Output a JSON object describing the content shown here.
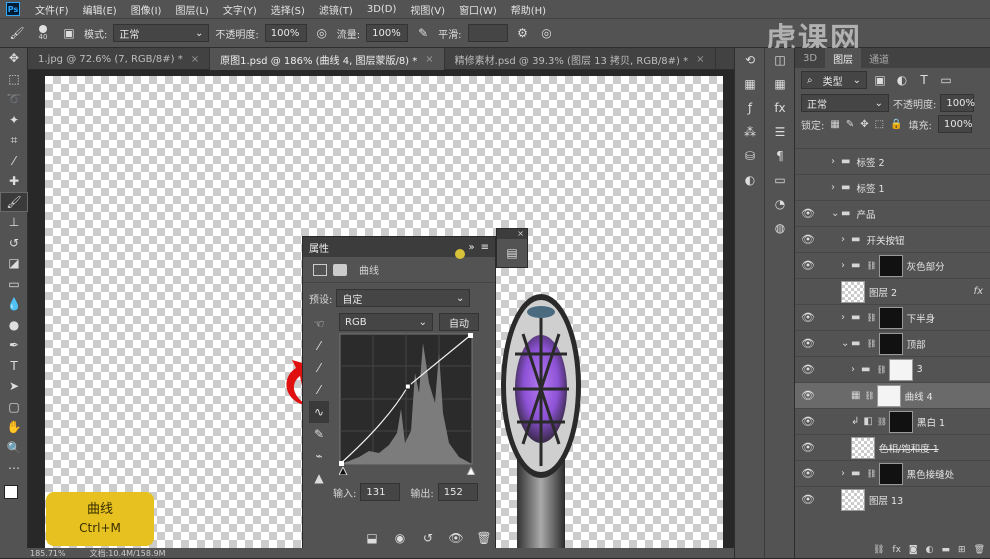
{
  "menubar": {
    "logo": "Ps",
    "items": [
      "文件(F)",
      "编辑(E)",
      "图像(I)",
      "图层(L)",
      "文字(Y)",
      "选择(S)",
      "滤镜(T)",
      "3D(D)",
      "视图(V)",
      "窗口(W)",
      "帮助(H)"
    ]
  },
  "options": {
    "brush_size": "40",
    "mode_label": "模式:",
    "mode_value": "正常",
    "opacity_label": "不透明度:",
    "opacity_value": "100%",
    "flow_label": "流量:",
    "flow_value": "100%",
    "smooth_label": "平滑:"
  },
  "tabs": [
    {
      "label": "1.jpg @ 72.6% (7, RGB/8#) *"
    },
    {
      "label": "原图1.psd @ 186% (曲线 4, 图层蒙版/8) *"
    },
    {
      "label": "精修素材.psd @ 39.3% (图层 13 拷贝, RGB/8#) *"
    }
  ],
  "status": {
    "zoom": "185.71%",
    "doc": "文档:10.4M/158.9M"
  },
  "properties": {
    "title": "属性",
    "subtitle": "曲线",
    "preset_label": "预设:",
    "preset_value": "自定",
    "channel_value": "RGB",
    "auto_label": "自动",
    "input_label": "输入:",
    "input_value": "131",
    "output_label": "输出:",
    "output_value": "152"
  },
  "curve_point": {
    "input": 131,
    "output": 152
  },
  "badge": {
    "line1": "曲线",
    "line2": "Ctrl+M"
  },
  "watermark": "虎课网",
  "layers_panel": {
    "tabs": [
      "3D",
      "图层",
      "通道"
    ],
    "filter_label": "类型",
    "blend_mode": "正常",
    "opacity_label": "不透明度:",
    "opacity_value": "100%",
    "lock_label": "锁定:",
    "fill_label": "填充:",
    "fill_value": "100%",
    "layers": [
      {
        "name": "标签 2",
        "kind": "group"
      },
      {
        "name": "标签 1",
        "kind": "group"
      },
      {
        "name": "产品",
        "kind": "group-open"
      },
      {
        "name": "开关按钮",
        "kind": "group"
      },
      {
        "name": "灰色部分",
        "kind": "group-mask"
      },
      {
        "name": "图层 2",
        "kind": "layer",
        "fx": "fx"
      },
      {
        "name": "下半身",
        "kind": "group-mask"
      },
      {
        "name": "顶部",
        "kind": "group-mask"
      },
      {
        "name": "3",
        "kind": "group-mask"
      },
      {
        "name": "曲线 4",
        "kind": "adjust",
        "selected": true
      },
      {
        "name": "黑白 1",
        "kind": "adjust-clip"
      },
      {
        "name": "色相/饱和度 1",
        "kind": "layer"
      },
      {
        "name": "黑色接缝处",
        "kind": "group-mask"
      },
      {
        "name": "图层 13",
        "kind": "layer"
      }
    ]
  }
}
